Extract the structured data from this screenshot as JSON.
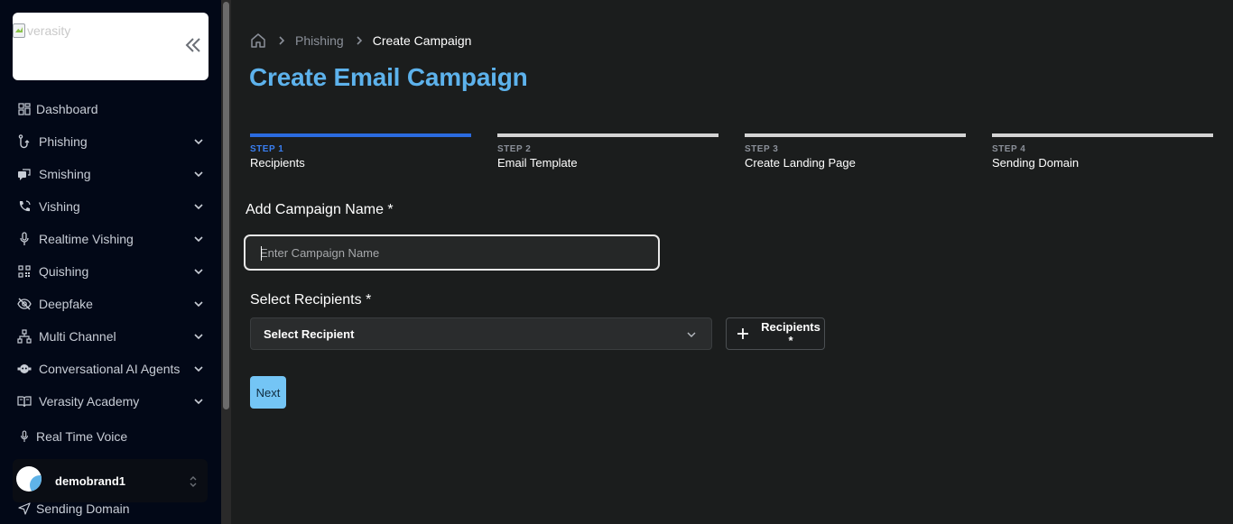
{
  "sidebar": {
    "logo_alt": "verasity",
    "items": [
      {
        "label": "Dashboard",
        "icon": "grid-icon",
        "expandable": false
      },
      {
        "label": "Phishing",
        "icon": "hook-icon",
        "expandable": true
      },
      {
        "label": "Smishing",
        "icon": "chat-icon",
        "expandable": true
      },
      {
        "label": "Vishing",
        "icon": "phone-icon",
        "expandable": true
      },
      {
        "label": "Realtime Vishing",
        "icon": "microphone-icon",
        "expandable": true
      },
      {
        "label": "Quishing",
        "icon": "qr-code-icon",
        "expandable": true
      },
      {
        "label": "Deepfake",
        "icon": "eye-off-icon",
        "expandable": true
      },
      {
        "label": "Multi Channel",
        "icon": "sitemap-icon",
        "expandable": true
      },
      {
        "label": "Conversational AI Agents",
        "icon": "robot-icon",
        "expandable": true
      },
      {
        "label": "Verasity Academy",
        "icon": "book-icon",
        "expandable": true
      },
      {
        "label": "Real Time Voice",
        "icon": "microphone-icon",
        "expandable": false
      },
      {
        "label": "Sending Domain",
        "icon": "send-icon",
        "expandable": false
      }
    ],
    "brand": {
      "name": "demobrand1"
    }
  },
  "breadcrumb": {
    "home_icon": "home-icon",
    "items": [
      "Phishing",
      "Create Campaign"
    ]
  },
  "page": {
    "title": "Create Email Campaign"
  },
  "steps": [
    {
      "number": "STEP 1",
      "name": "Recipients",
      "active": true
    },
    {
      "number": "STEP 2",
      "name": "Email Template",
      "active": false
    },
    {
      "number": "STEP 3",
      "name": "Create Landing Page",
      "active": false
    },
    {
      "number": "STEP 4",
      "name": "Sending Domain",
      "active": false
    }
  ],
  "form": {
    "campaign_name_label": "Add Campaign Name *",
    "campaign_name_value": "",
    "campaign_name_placeholder": "Enter Campaign Name",
    "recipients_label": "Select Recipients *",
    "recipient_select_value": "Select Recipient",
    "add_recipients_label": "Recipients *",
    "next_label": "Next"
  },
  "colors": {
    "accent": "#5db2ec",
    "step_active": "#2b6be0",
    "next_button": "#74c5f5",
    "sidebar_bg": "#020817",
    "main_bg": "#1b1d1d"
  }
}
